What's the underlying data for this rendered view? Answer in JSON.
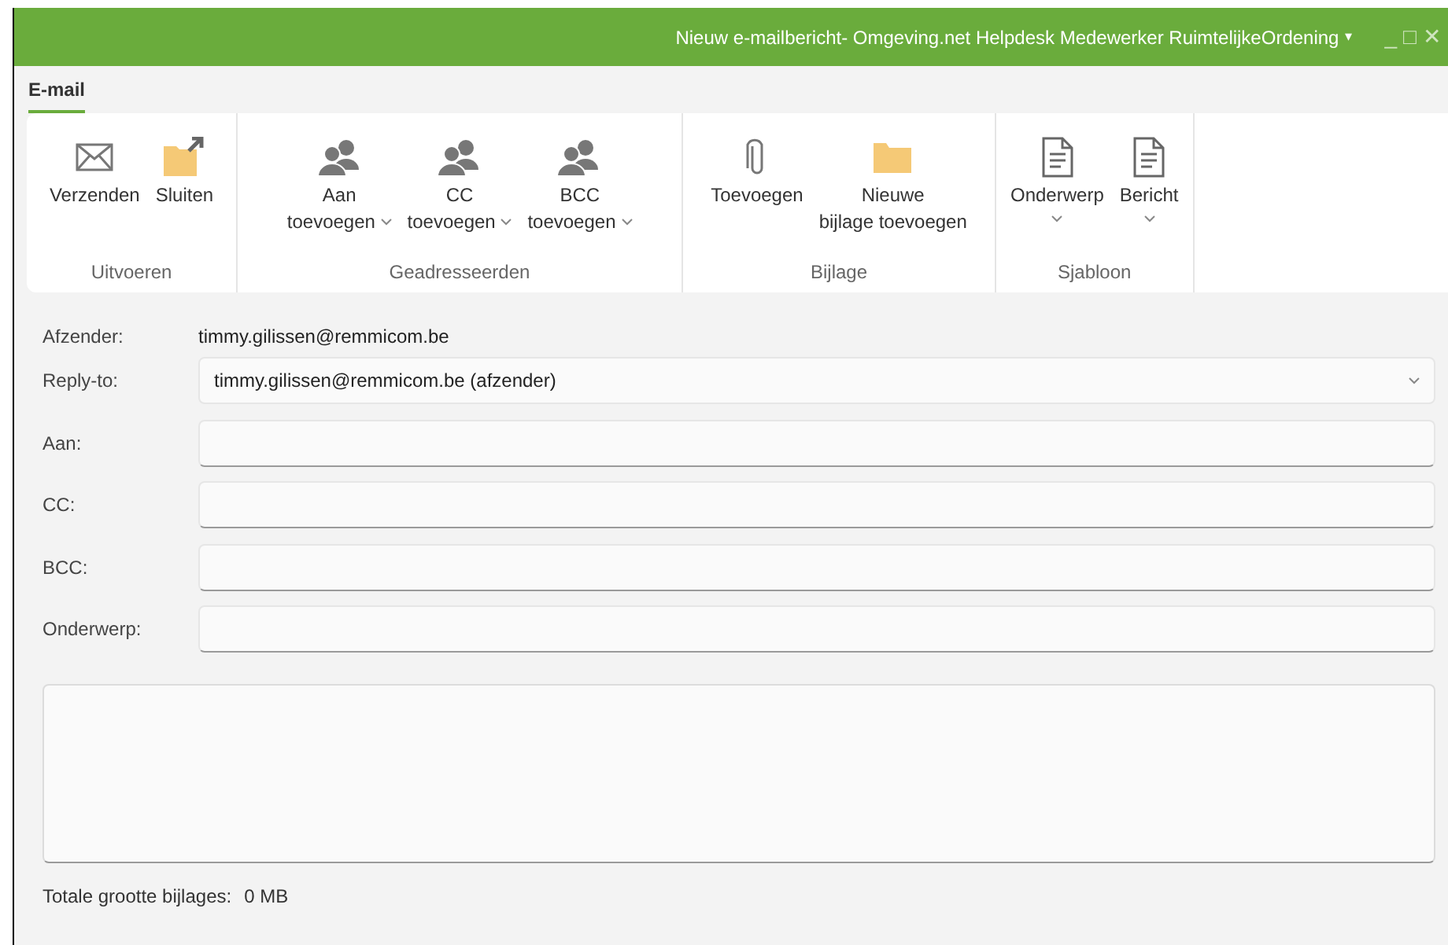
{
  "window": {
    "title": "Nieuw e-mailbericht- Omgeving.net Helpdesk Medewerker RuimtelijkeOrdening",
    "title_menu": "▾",
    "controls": [
      "_",
      "□",
      "✕"
    ]
  },
  "tabs": [
    {
      "label": "E-mail",
      "selected": true
    }
  ],
  "ribbon": {
    "groups": [
      {
        "label": "Uitvoeren",
        "buttons": [
          {
            "kind": "envelope",
            "lines": [
              "Verzenden"
            ],
            "dropdown": false
          },
          {
            "kind": "folder-arrow",
            "lines": [
              "Sluiten"
            ],
            "dropdown": false
          }
        ]
      },
      {
        "label": "Geadresseerden",
        "buttons": [
          {
            "kind": "people",
            "lines": [
              "Aan",
              "toevoegen"
            ],
            "dropdown": true
          },
          {
            "kind": "people",
            "lines": [
              "CC",
              "toevoegen"
            ],
            "dropdown": true
          },
          {
            "kind": "people",
            "lines": [
              "BCC",
              "toevoegen"
            ],
            "dropdown": true
          }
        ]
      },
      {
        "label": "Bijlage",
        "buttons": [
          {
            "kind": "paperclip",
            "lines": [
              "Toevoegen"
            ],
            "dropdown": false
          },
          {
            "kind": "folder",
            "lines": [
              "Nieuwe",
              "bijlage toevoegen"
            ],
            "dropdown": false
          }
        ]
      },
      {
        "label": "Sjabloon",
        "buttons": [
          {
            "kind": "document",
            "lines": [
              "Onderwerp"
            ],
            "dropdown": true
          },
          {
            "kind": "document",
            "lines": [
              "Bericht"
            ],
            "dropdown": true
          }
        ]
      }
    ]
  },
  "form": {
    "fields": [
      {
        "kind": "text",
        "label": "Afzender:",
        "value": "timmy.gilissen@remmicom.be"
      },
      {
        "kind": "select",
        "label": "Reply-to:",
        "value": "timmy.gilissen@remmicom.be (afzender)"
      },
      {
        "kind": "input",
        "label": "Aan:"
      },
      {
        "kind": "input",
        "label": "CC:"
      },
      {
        "kind": "input",
        "label": "BCC:"
      },
      {
        "kind": "input",
        "label": "Onderwerp:"
      }
    ]
  },
  "status": {
    "label": "Totale grootte bijlages:",
    "value": "0 MB"
  }
}
